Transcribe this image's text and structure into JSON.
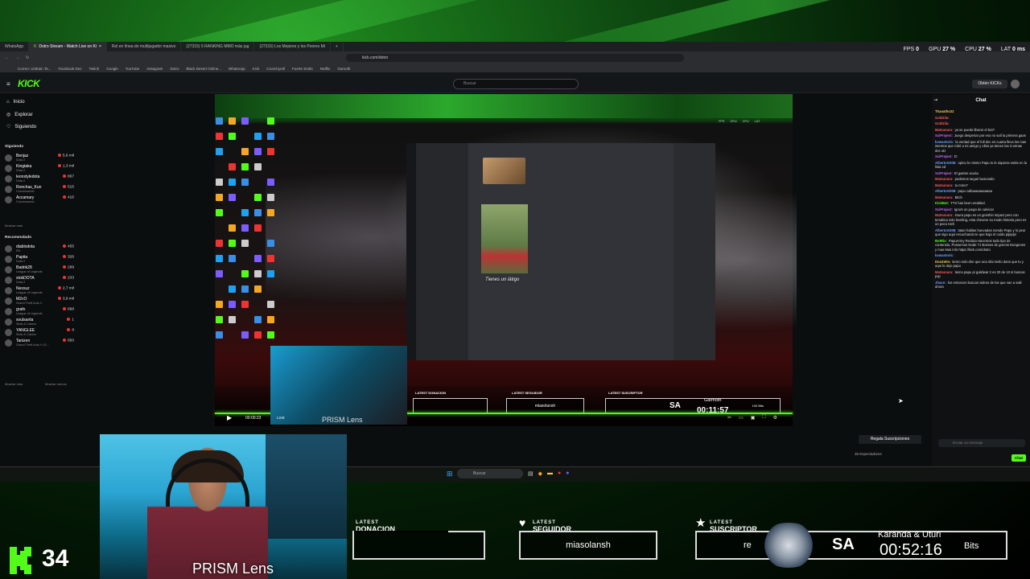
{
  "hud": {
    "fps_label": "FPS",
    "fps": "0",
    "gpu_label": "GPU",
    "gpu": "27 %",
    "cpu_label": "CPU",
    "cpu": "27 %",
    "lat_label": "LAT",
    "lat": "0 ms"
  },
  "browser": {
    "tabs": [
      "WhatsApp",
      "Dotro Stream - Watch Live on Ki",
      "Rol en línea de multijugador masivo",
      "(27315) 5 RANKING MMO más jug",
      "(27315) Los Mejores y los Peores Mi"
    ],
    "url": "kick.com/dotro",
    "bookmarks": [
      "Correo: Unitrain Ta...",
      "Facebook Dez",
      "Twitch",
      "Google",
      "YouTube",
      "Instagram",
      "Dotro",
      "Black Desert Online...",
      "WhatsApp",
      "Kick",
      "Crunchyroll",
      "Fuerte SUBs",
      "Netflix",
      "Gamoth"
    ]
  },
  "kick": {
    "logo": "KICK",
    "search_placeholder": "Buscar",
    "obtain": "Obtén KICKs",
    "nav": [
      "Inicio",
      "Explorar",
      "Siguiendo"
    ],
    "following_header": "Siguiendo",
    "following": [
      {
        "name": "Benjaz",
        "game": "Dota 2",
        "viewers": "5,6 mil"
      },
      {
        "name": "Kingtaka",
        "game": "Dota 2",
        "viewers": "1,3 mil"
      },
      {
        "name": "leonstyledota",
        "game": "Dota 2",
        "viewers": "867"
      },
      {
        "name": "Ronchas_Kun",
        "game": "Conversando",
        "viewers": "515"
      },
      {
        "name": "Accamary",
        "game": "Conversando",
        "viewers": "415"
      }
    ],
    "more1": "Mostrar más",
    "recommended_header": "Recomendado",
    "recommended": [
      {
        "name": "diablodota",
        "game": "IRL",
        "viewers": "455"
      },
      {
        "name": "Papita",
        "game": "Dota 2",
        "viewers": "326"
      },
      {
        "name": "Badrik28",
        "game": "League of Legends",
        "viewers": "299"
      },
      {
        "name": "xtokDOTA",
        "game": "Dota 2",
        "viewers": "233"
      },
      {
        "name": "Nexxuz",
        "game": "League of Legends",
        "viewers": "2,7 mil"
      },
      {
        "name": "M2cO",
        "game": "Grand Theft Auto V",
        "viewers": "3,9 mil"
      },
      {
        "name": "grafo",
        "game": "League of Legends",
        "viewers": "698"
      },
      {
        "name": "soulsanta",
        "game": "Slots & Casino",
        "viewers": "1"
      },
      {
        "name": "YANGLEE",
        "game": "Slots & Casino",
        "viewers": "8"
      },
      {
        "name": "Tanizen",
        "game": "Grand Theft Auto V (G...",
        "viewers": "650"
      }
    ],
    "more2": "Mostrar más",
    "less": "Mostrar menos"
  },
  "stream": {
    "caption": "Tienes un látigo",
    "livetime": "00:00:23",
    "live": "LIVE",
    "prism": "PRISM Lens",
    "inner_don": "LATEST DONACION",
    "inner_seg": "LATEST SEGUIDOR",
    "inner_seg_val": "miasolansh",
    "inner_sub": "LATEST SUSCRIPTOR",
    "inner_sa": "SA",
    "inner_name": "Garmoth",
    "inner_time": "00:11:57",
    "inner_bits": "100 Bits"
  },
  "chat": {
    "title": "Chat",
    "messages": [
      {
        "user": "Thanatho22",
        "color": "#f7c948",
        "text": ""
      },
      {
        "user": "Goldzila:",
        "color": "#ff5959",
        "text": ""
      },
      {
        "user": "Goldzila:",
        "color": "#ff5959",
        "text": ""
      },
      {
        "user": "Matsunaru:",
        "color": "#ff5959",
        "text": "ya se puede liberar el bot?"
      },
      {
        "user": "SciProject:",
        "color": "#c56cf0",
        "text": "Juego despertar por eso no salí la primera gaas"
      },
      {
        "user": "kowastoris:",
        "color": "#6ca0ff",
        "text": "la verdad que el full dec es cuarta lleva los mas intentos que robó a mi amigo y ellos ya tienen las 3 armas dec xD"
      },
      {
        "user": "SciProject:",
        "color": "#c56cf0",
        "text": "D:"
      },
      {
        "user": "AlbertoXD08:",
        "color": "#6ca0ff",
        "text": "opino lo mismo Papu tu le siquiera estás en la lista xd"
      },
      {
        "user": "SciProject:",
        "color": "#c56cf0",
        "text": "El gaston acuáu"
      },
      {
        "user": "Matsunaru:",
        "color": "#ff5959",
        "text": "podemos seguir buscando"
      },
      {
        "user": "Matsunaru:",
        "color": "#ff5959",
        "text": "tu mmo?"
      },
      {
        "user": "AlbertoXD08:",
        "color": "#6ca0ff",
        "text": "papu callaaaaaaaaaaa"
      },
      {
        "user": "Matsunaru:",
        "color": "#ff5959",
        "text": "Bitch"
      },
      {
        "user": "KickBot:",
        "color": "#53fc18",
        "text": "TTS has been enabled."
      },
      {
        "user": "SciProject:",
        "color": "#c56cf0",
        "text": "Igrunt un juego de calvicar"
      },
      {
        "user": "Matsunaru:",
        "color": "#ff5959",
        "text": "imura papu es un genshin impact pero con temática solo leveling, esta chevere su modo historia pero es un poco meh"
      },
      {
        "user": "AlbertoXD08:",
        "color": "#6ca0ff",
        "text": "tatan hablas huevadas nomás Papu y lo peor que sigo aquí escuchando te que bajo el caído pipipipi"
      },
      {
        "user": "BotRix:",
        "color": "#53fc18",
        "text": "PapuArmy Recluta Hacemos todo tipo de contenido, Poseemos Node 71 Bosses de gremio Dungeons y mas Mas info https://kick.com/dotro"
      },
      {
        "user": "kowastoris:",
        "color": "#6ca0ff",
        "text": ""
      },
      {
        "user": "DonZelm:",
        "color": "#f7c948",
        "text": "tiemo solo dire que una sfai melio dans que tu y aqui lo dejo papu"
      },
      {
        "user": "Matsunaru:",
        "color": "#ff5959",
        "text": "tiemo papu pi guildwar 2 es 20 de 10 si buscas pvp"
      },
      {
        "user": "JhasA:",
        "color": "#6ca0ff",
        "text": "los entonces buscas videos de los que van a salir ahora"
      }
    ],
    "input_placeholder": "Enviar un mensaje",
    "send": "Chat",
    "gift": "Regala Suscripciones",
    "viewers": "35 Espectadores"
  },
  "taskbar": {
    "search": "Buscar"
  },
  "overlay": {
    "kick_count": "34",
    "prism": "PRISM Lens",
    "latest": "LATEST",
    "don_label": "DONACION",
    "seg_label": "SEGUIDOR",
    "seg_value": "miasolansh",
    "sub_label": "SUSCRIPTOR",
    "sub_value": "re",
    "sa": "SA",
    "timer_name": "Karanda & Uturi",
    "timer": "00:52:16",
    "bits": "Bits"
  }
}
